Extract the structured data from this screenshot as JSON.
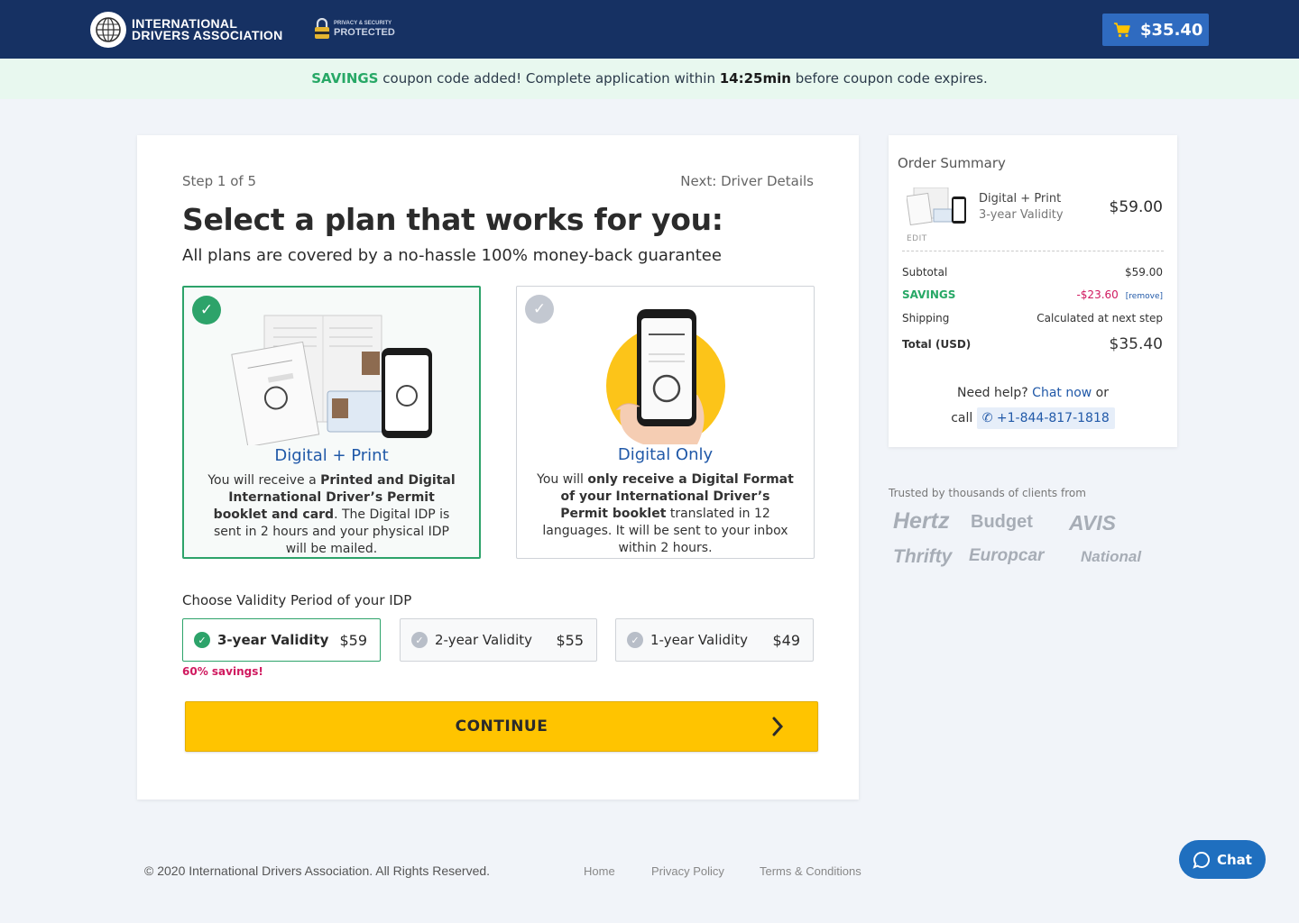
{
  "header": {
    "logo_line1": "INTERNATIONAL",
    "logo_line2": "DRIVERS ASSOCIATION",
    "privacy_small": "PRIVACY & SECURITY",
    "privacy_big": "PROTECTED",
    "cart_total": "$35.40"
  },
  "coupon": {
    "code": "SAVINGS",
    "text_before_timer": " coupon code added! Complete application within ",
    "timer": "14:25min",
    "text_after_timer": " before coupon code expires."
  },
  "main": {
    "step": "Step 1 of 5",
    "next": "Next: Driver Details",
    "title": "Select a plan that works for you:",
    "subtitle": "All plans are covered by a no-hassle 100% money-back guarantee",
    "plans": [
      {
        "name": "Digital + Print",
        "selected": true,
        "desc_1": "You will receive a ",
        "desc_2": "Printed and Digital International Driver’s Permit booklet and card",
        "desc_3": ". The Digital IDP is sent in 2 hours and your physical IDP will be mailed."
      },
      {
        "name": "Digital Only",
        "selected": false,
        "desc_1": "You will ",
        "desc_2": "only receive a Digital Format of your International Driver’s Permit booklet",
        "desc_3": " translated in 12 languages. It will be sent to your inbox within 2 hours."
      }
    ],
    "validity_label": "Choose Validity Period of your IDP",
    "validity_options": [
      {
        "label": "3-year Validity",
        "price": "$59",
        "selected": true
      },
      {
        "label": "2-year Validity",
        "price": "$55",
        "selected": false
      },
      {
        "label": "1-year Validity",
        "price": "$49",
        "selected": false
      }
    ],
    "savings_note": "60% savings!",
    "continue_label": "CONTINUE"
  },
  "summary": {
    "title": "Order Summary",
    "product_name": "Digital + Print",
    "product_sub": "3-year Validity",
    "product_price": "$59.00",
    "edit": "EDIT",
    "subtotal_label": "Subtotal",
    "subtotal_value": "$59.00",
    "savings_label": "SAVINGS",
    "savings_value": "-$23.60",
    "remove": "[remove]",
    "shipping_label": "Shipping",
    "shipping_value": "Calculated at next step",
    "total_label": "Total (USD)",
    "total_value": "$35.40",
    "help_prefix": "Need help? ",
    "chat_now": "Chat now",
    "help_or": " or",
    "call": "call ",
    "phone": "+1-844-817-1818"
  },
  "trusted": {
    "label": "Trusted by thousands of clients from",
    "brands": [
      "Hertz",
      "Budget",
      "AVIS",
      "Thrifty",
      "Europcar",
      "National"
    ]
  },
  "footer": {
    "copyright": "© 2020 International Drivers Association. All Rights Reserved.",
    "links": [
      "Home",
      "Privacy Policy",
      "Terms & Conditions"
    ],
    "chat": "Chat"
  },
  "colors": {
    "header_bg": "#163163",
    "accent_green": "#2da36a",
    "accent_blue": "#2159a8",
    "cta_yellow": "#ffc400",
    "savings_red": "#d0195f"
  }
}
